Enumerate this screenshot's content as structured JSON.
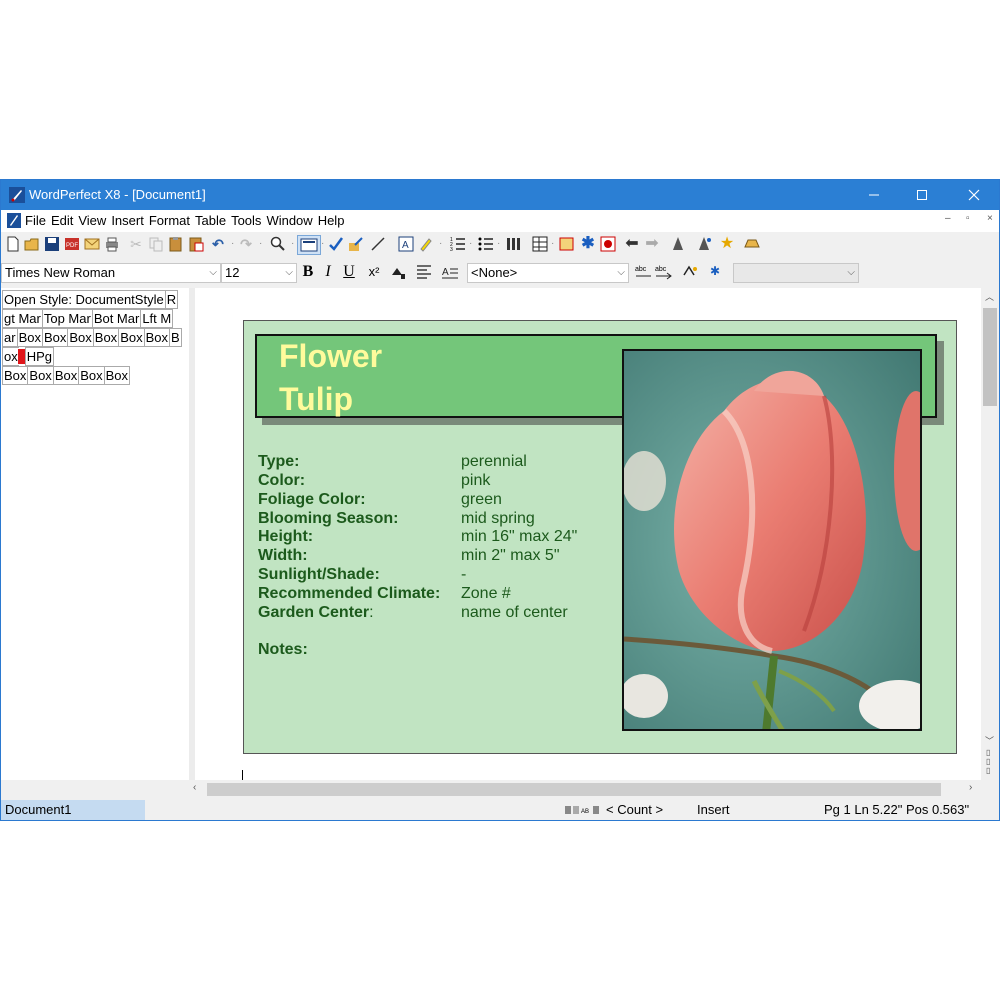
{
  "window": {
    "title": "WordPerfect X8 - [Document1]"
  },
  "menu": [
    "File",
    "Edit",
    "View",
    "Insert",
    "Format",
    "Table",
    "Tools",
    "Window",
    "Help"
  ],
  "toolbar2": {
    "font": "Times New Roman",
    "size": "12",
    "style": "<None>",
    "bold": "B",
    "italic": "I",
    "underline": "U",
    "superscript": "x²"
  },
  "reveal_codes": {
    "rows": [
      [
        "Open Style: DocumentStyle",
        "R"
      ],
      [
        "gt Mar",
        "Top Mar",
        "Bot Mar",
        "Lft M"
      ],
      [
        "ar",
        "Box",
        "Box",
        "Box",
        "Box",
        "Box",
        "Box",
        "B"
      ],
      [
        "ox",
        "",
        "HPg"
      ],
      [
        "Box",
        "Box",
        "Box",
        "Box",
        "Box"
      ]
    ]
  },
  "card": {
    "title1": "Flower",
    "title2": "Tulip",
    "fields": [
      {
        "label": "Type:",
        "value": "perennial"
      },
      {
        "label": "Color:",
        "value": "pink"
      },
      {
        "label": "Foliage Color:",
        "value": "green"
      },
      {
        "label": "Blooming Season:",
        "value": "mid spring"
      },
      {
        "label": "Height:",
        "value": "min 16\" max 24\""
      },
      {
        "label": "Width:",
        "value": "min 2\" max 5\""
      },
      {
        "label": "Sunlight/Shade:",
        "value": "-"
      },
      {
        "label": "Recommended Climate:",
        "value": "Zone #"
      },
      {
        "label": "Garden Center",
        "value": "name of center"
      }
    ],
    "garden_colon": ":",
    "notes_label": "Notes:"
  },
  "status": {
    "document": "Document1",
    "count": "< Count >",
    "mode": "Insert",
    "position": "Pg 1 Ln 5.22\" Pos 0.563\""
  },
  "colors": {
    "titlebar": "#2b7fd4",
    "card_bg": "#c1e4c2",
    "banner": "#74c67a",
    "title_text": "#fffb9c",
    "field_text": "#1c5a1c"
  }
}
